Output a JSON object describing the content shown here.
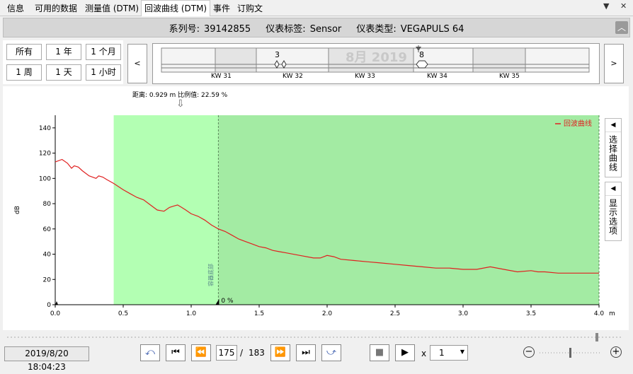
{
  "tabs": [
    {
      "label": "信息",
      "active": false
    },
    {
      "label": "可用的数据",
      "active": false
    },
    {
      "label": "测量值 (DTM)",
      "active": false
    },
    {
      "label": "回波曲线 (DTM)",
      "active": true
    },
    {
      "label": "事件",
      "active": false
    },
    {
      "label": "订购文",
      "active": false
    }
  ],
  "header": {
    "serial_label": "系列号:",
    "serial_value": "39142855",
    "tag_label": "仪表标签:",
    "tag_value": "Sensor",
    "type_label": "仪表类型:",
    "type_value": "VEGAPULS 64"
  },
  "period_buttons": [
    "所有",
    "1 年",
    "1 个月",
    "1 周",
    "1 天",
    "1 小时"
  ],
  "timeline": {
    "month_label": "8月 2019",
    "week_labels": [
      "KW 31",
      "KW 32",
      "KW 33",
      "KW 34",
      "KW 35"
    ],
    "event_labels": [
      "3",
      "8"
    ]
  },
  "marker_text": "距离: 0.929 m 比例值: 22.59 %",
  "chart_data": {
    "type": "line",
    "xlabel": "m",
    "ylabel": "dB",
    "xlim": [
      0,
      4
    ],
    "ylim": [
      0,
      150
    ],
    "x_ticks": [
      "0.0",
      "0.5",
      "1.0",
      "1.5",
      "2.0",
      "2.5",
      "3.0",
      "3.5",
      "4.0"
    ],
    "y_ticks": [
      "0",
      "20",
      "40",
      "60",
      "80",
      "100",
      "120",
      "140"
    ],
    "legend": "top-right",
    "series": [
      {
        "name": "回波曲线",
        "color": "#e02020",
        "x": [
          0,
          0.05,
          0.09,
          0.12,
          0.14,
          0.17,
          0.2,
          0.25,
          0.3,
          0.32,
          0.35,
          0.38,
          0.43,
          0.5,
          0.55,
          0.6,
          0.65,
          0.7,
          0.75,
          0.8,
          0.84,
          0.87,
          0.9,
          0.93,
          0.96,
          1.0,
          1.05,
          1.1,
          1.15,
          1.2,
          1.25,
          1.3,
          1.35,
          1.4,
          1.45,
          1.5,
          1.55,
          1.6,
          1.65,
          1.7,
          1.8,
          1.9,
          1.95,
          2.0,
          2.05,
          2.1,
          2.2,
          2.3,
          2.4,
          2.5,
          2.6,
          2.7,
          2.8,
          2.9,
          3.0,
          3.1,
          3.2,
          3.3,
          3.4,
          3.5,
          3.55,
          3.6,
          3.7,
          3.8,
          3.9,
          4.0
        ],
        "y": [
          113,
          115,
          112,
          108,
          110,
          109,
          106,
          102,
          100,
          102,
          101,
          99,
          96,
          91,
          88,
          85,
          83,
          79,
          75,
          74,
          77,
          78,
          79,
          77,
          75,
          72,
          70,
          67,
          63,
          60,
          58,
          55,
          52,
          50,
          48,
          46,
          45,
          43,
          42,
          41,
          39,
          37,
          37,
          39,
          38,
          36,
          35,
          34,
          33,
          32,
          31,
          30,
          29,
          29,
          28,
          28,
          30,
          28,
          26,
          27,
          26,
          26,
          25,
          25,
          25,
          25
        ]
      }
    ],
    "annotations": {
      "threshold_label": "0 %",
      "vertical_label": "容器底部"
    }
  },
  "bottom": {
    "timestamp": "2019/8/20 18:04:23",
    "frame_current": "175",
    "frame_sep": "/",
    "frame_total": "183",
    "speed_prefix": "x",
    "speed_value": "1"
  },
  "side_buttons": {
    "select_curves": "选择曲线",
    "display_options": "显示选项"
  },
  "colors": {
    "accent": "#e02020",
    "zone_light": "#b3ffb3",
    "zone_dark": "#a3eba3"
  }
}
